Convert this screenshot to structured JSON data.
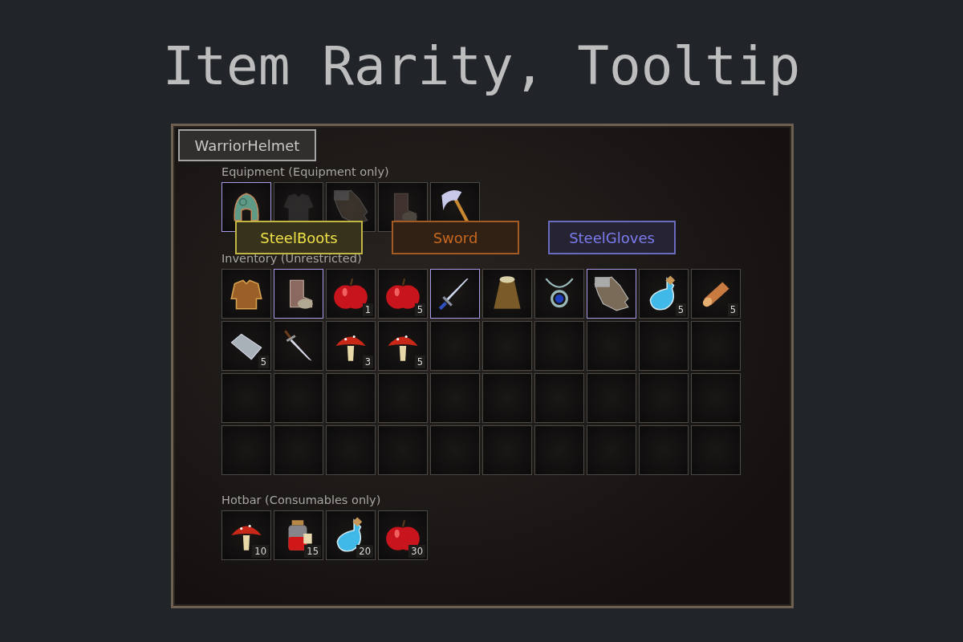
{
  "title": "Item Rarity, Tooltip",
  "equipment": {
    "label": "Equipment (Equipment only)",
    "slots": [
      {
        "kind": "helmet",
        "color": "#a89ce8",
        "empty": false
      },
      {
        "kind": "chest",
        "color": "#4c4844",
        "empty": true
      },
      {
        "kind": "gloves",
        "color": "#4c4844",
        "empty": true
      },
      {
        "kind": "boots",
        "color": "#4c4844",
        "empty": true
      },
      {
        "kind": "axe",
        "color": "#4c4844",
        "empty": false
      }
    ]
  },
  "inventory": {
    "label": "Inventory (Unrestricted)",
    "rows": [
      [
        {
          "kind": "armor",
          "color": "#4c4844"
        },
        {
          "kind": "boots",
          "color": "#a89ce8"
        },
        {
          "kind": "apple",
          "color": "#4c4844",
          "count": "1"
        },
        {
          "kind": "apple",
          "color": "#4c4844",
          "count": "5"
        },
        {
          "kind": "sword",
          "color": "#a89ce8"
        },
        {
          "kind": "cloak",
          "color": "#4c4844"
        },
        {
          "kind": "amulet",
          "color": "#4c4844"
        },
        {
          "kind": "gloves",
          "color": "#a89ce8"
        },
        {
          "kind": "potion",
          "color": "#4c4844",
          "count": "5"
        },
        {
          "kind": "log",
          "color": "#4c4844",
          "count": "5"
        }
      ],
      [
        {
          "kind": "ingot",
          "color": "#4c4844",
          "count": "5"
        },
        {
          "kind": "dagger",
          "color": "#4c4844"
        },
        {
          "kind": "mushroom",
          "color": "#4c4844",
          "count": "3"
        },
        {
          "kind": "mushroom",
          "color": "#4c4844",
          "count": "5"
        },
        {
          "kind": "empty"
        },
        {
          "kind": "empty"
        },
        {
          "kind": "empty"
        },
        {
          "kind": "empty"
        },
        {
          "kind": "empty"
        },
        {
          "kind": "empty"
        }
      ],
      [
        {
          "kind": "empty"
        },
        {
          "kind": "empty"
        },
        {
          "kind": "empty"
        },
        {
          "kind": "empty"
        },
        {
          "kind": "empty"
        },
        {
          "kind": "empty"
        },
        {
          "kind": "empty"
        },
        {
          "kind": "empty"
        },
        {
          "kind": "empty"
        },
        {
          "kind": "empty"
        }
      ],
      [
        {
          "kind": "empty"
        },
        {
          "kind": "empty"
        },
        {
          "kind": "empty"
        },
        {
          "kind": "empty"
        },
        {
          "kind": "empty"
        },
        {
          "kind": "empty"
        },
        {
          "kind": "empty"
        },
        {
          "kind": "empty"
        },
        {
          "kind": "empty"
        },
        {
          "kind": "empty"
        }
      ]
    ]
  },
  "hotbar": {
    "label": "Hotbar (Consumables only)",
    "slots": [
      {
        "kind": "mushroom",
        "color": "#4c4844",
        "count": "10"
      },
      {
        "kind": "jar",
        "color": "#4c4844",
        "count": "15"
      },
      {
        "kind": "potion",
        "color": "#4c4844",
        "count": "20"
      },
      {
        "kind": "apple",
        "color": "#4c4844",
        "count": "30"
      }
    ]
  },
  "tooltips": [
    {
      "text": "WarriorHelmet",
      "color": "#c8c8c8"
    },
    {
      "text": "SteelBoots",
      "color": "#f0e048"
    },
    {
      "text": "Sword",
      "color": "#c8681e"
    },
    {
      "text": "SteelGloves",
      "color": "#7c7cf0"
    }
  ]
}
